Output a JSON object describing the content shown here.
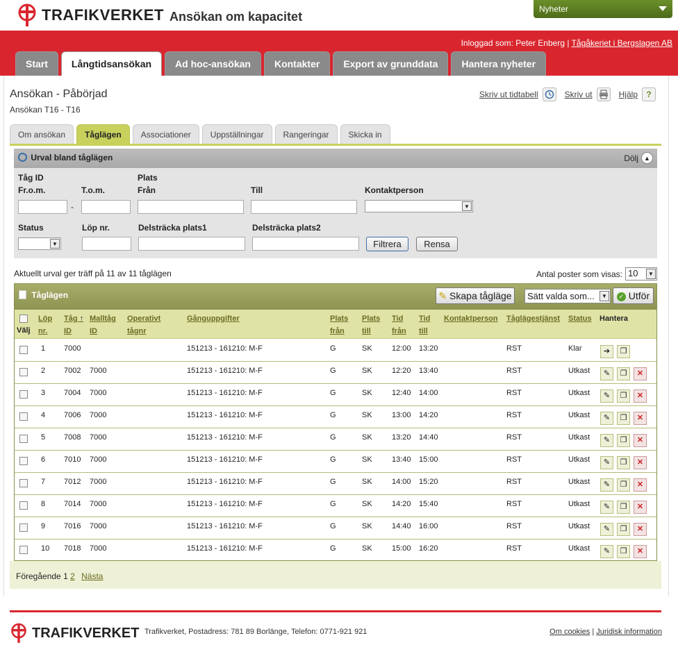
{
  "header": {
    "brand": "TRAFIKVERKET",
    "app_title": "Ansökan om kapacitet",
    "news_label": "Nyheter",
    "logged_in_prefix": "Inloggad som: Peter Enberg |",
    "logged_in_company": "Tågåkeriet i Bergslagen AB"
  },
  "main_tabs": [
    "Start",
    "Långtidsansökan",
    "Ad hoc-ansökan",
    "Kontakter",
    "Export av grunddata",
    "Hantera nyheter"
  ],
  "page": {
    "title": "Ansökan - Påbörjad",
    "subtitle": "Ansökan T16 - T16",
    "print_timetable": "Skriv ut tidtabell",
    "print": "Skriv ut",
    "help": "Hjälp",
    "help_icon": "?"
  },
  "sub_tabs": [
    "Om ansökan",
    "Tåglägen",
    "Associationer",
    "Uppställningar",
    "Rangeringar",
    "Skicka in"
  ],
  "filter": {
    "title": "Urval bland tåglägen",
    "hide": "Dölj",
    "tag_id": "Tåg ID",
    "from": "Fr.o.m.",
    "to": "T.o.m.",
    "dash": "-",
    "plats": "Plats",
    "plats_from": "Från",
    "plats_to": "Till",
    "contact": "Kontaktperson",
    "status": "Status",
    "lop_nr": "Löp nr.",
    "del1": "Delsträcka plats1",
    "del2": "Delsträcka plats2",
    "filter_btn": "Filtrera",
    "clear_btn": "Rensa"
  },
  "summary": "Aktuellt urval ger träff på 11 av 11 tåglägen",
  "per_page_label": "Antal poster som visas:",
  "per_page_value": "10",
  "table": {
    "title": "Tåglägen",
    "create_btn": "Skapa tågläge",
    "bulk_select": "Sätt valda som...",
    "execute_btn": "Utför",
    "headers": {
      "valj": "Välj",
      "lop1": "Löp",
      "lop2": "nr.",
      "tag1": "Tåg",
      "tag2": "ID",
      "sort": "↑",
      "mall1": "Malltåg",
      "mall2": "ID",
      "op1": "Operativt",
      "op2": "tågnr",
      "gang": "Gånguppgifter",
      "pf1": "Plats",
      "pf2": "från",
      "pt1": "Plats",
      "pt2": "till",
      "tf1": "Tid",
      "tf2": "från",
      "tt1": "Tid",
      "tt2": "till",
      "kontakt": "Kontaktperson",
      "tjanst": "Tåglägestjänst",
      "status": "Status",
      "hantera": "Hantera"
    },
    "rows": [
      {
        "lop": "1",
        "tag": "7000",
        "mall": "",
        "gang": "151213 - 161210: M-F",
        "pf": "G",
        "pt": "SK",
        "tf": "12:00",
        "tt": "13:20",
        "tjanst": "RST",
        "status": "Klar"
      },
      {
        "lop": "2",
        "tag": "7002",
        "mall": "7000",
        "gang": "151213 - 161210: M-F",
        "pf": "G",
        "pt": "SK",
        "tf": "12:20",
        "tt": "13:40",
        "tjanst": "RST",
        "status": "Utkast"
      },
      {
        "lop": "3",
        "tag": "7004",
        "mall": "7000",
        "gang": "151213 - 161210: M-F",
        "pf": "G",
        "pt": "SK",
        "tf": "12:40",
        "tt": "14:00",
        "tjanst": "RST",
        "status": "Utkast"
      },
      {
        "lop": "4",
        "tag": "7006",
        "mall": "7000",
        "gang": "151213 - 161210: M-F",
        "pf": "G",
        "pt": "SK",
        "tf": "13:00",
        "tt": "14:20",
        "tjanst": "RST",
        "status": "Utkast"
      },
      {
        "lop": "5",
        "tag": "7008",
        "mall": "7000",
        "gang": "151213 - 161210: M-F",
        "pf": "G",
        "pt": "SK",
        "tf": "13:20",
        "tt": "14:40",
        "tjanst": "RST",
        "status": "Utkast"
      },
      {
        "lop": "6",
        "tag": "7010",
        "mall": "7000",
        "gang": "151213 - 161210: M-F",
        "pf": "G",
        "pt": "SK",
        "tf": "13:40",
        "tt": "15:00",
        "tjanst": "RST",
        "status": "Utkast"
      },
      {
        "lop": "7",
        "tag": "7012",
        "mall": "7000",
        "gang": "151213 - 161210: M-F",
        "pf": "G",
        "pt": "SK",
        "tf": "14:00",
        "tt": "15:20",
        "tjanst": "RST",
        "status": "Utkast"
      },
      {
        "lop": "8",
        "tag": "7014",
        "mall": "7000",
        "gang": "151213 - 161210: M-F",
        "pf": "G",
        "pt": "SK",
        "tf": "14:20",
        "tt": "15:40",
        "tjanst": "RST",
        "status": "Utkast"
      },
      {
        "lop": "9",
        "tag": "7016",
        "mall": "7000",
        "gang": "151213 - 161210: M-F",
        "pf": "G",
        "pt": "SK",
        "tf": "14:40",
        "tt": "16:00",
        "tjanst": "RST",
        "status": "Utkast"
      },
      {
        "lop": "10",
        "tag": "7018",
        "mall": "7000",
        "gang": "151213 - 161210: M-F",
        "pf": "G",
        "pt": "SK",
        "tf": "15:00",
        "tt": "16:20",
        "tjanst": "RST",
        "status": "Utkast"
      }
    ]
  },
  "pager": {
    "prev": "Föregående",
    "page1": "1",
    "page2": "2",
    "next": "Nästa"
  },
  "footer": {
    "brand": "TRAFIKVERKET",
    "address": "Trafikverket, Postadress: 781 89 Borlänge, Telefon: 0771-921 921",
    "cookies": "Om cookies",
    "separator": "|",
    "legal": "Juridisk information"
  },
  "colors": {
    "brand_red": "#d9262e",
    "olive": "#8d9350",
    "accent_green": "#c8d15c"
  }
}
